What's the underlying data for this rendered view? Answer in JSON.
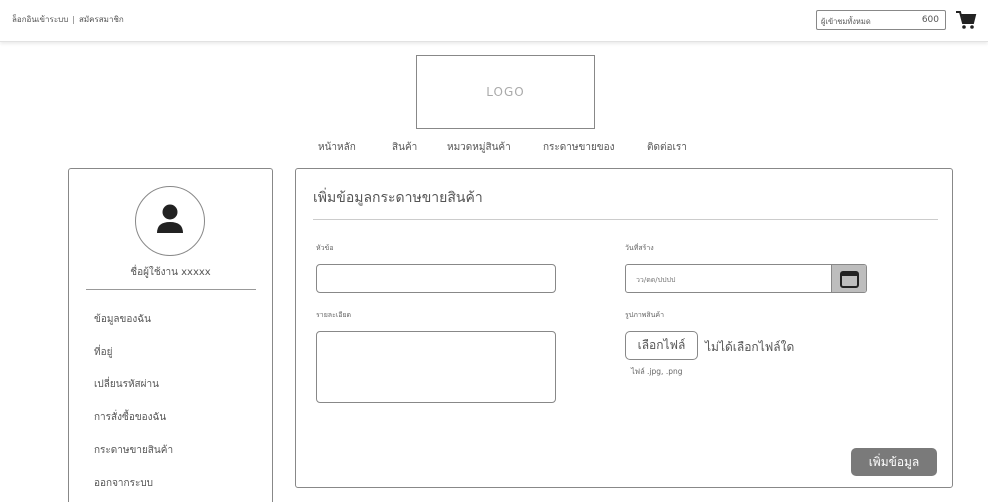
{
  "header": {
    "login_label": "ล็อกอินเข้าระบบ",
    "register_label": "สมัครสมาชิก",
    "separator": "|",
    "visitor_label": "ผู้เข้าชมทั้งหมด",
    "visitor_count": "600"
  },
  "logo": {
    "text": "LOGO"
  },
  "nav": {
    "items": [
      "หน้าหลัก",
      "สินค้า",
      "หมวดหมู่สินค้า",
      "กระดาษขายของ",
      "ติดต่อเรา"
    ]
  },
  "sidebar": {
    "username": "ชื่อผู้ใช้งาน xxxxx",
    "menu": [
      "ข้อมูลของฉัน",
      "ที่อยู่",
      "เปลี่ยนรหัสผ่าน",
      "การสั่งซื้อของฉัน",
      "กระดาษขายสินค้า",
      "ออกจากระบบ"
    ]
  },
  "form": {
    "title": "เพิ่มข้อมูลกระดาษขายสินค้า",
    "topic_label": "หัวข้อ",
    "topic_value": "",
    "date_label": "วันที่สร้าง",
    "date_placeholder": "วว/ดด/ปปปป",
    "detail_label": "รายละเอียด",
    "detail_value": "",
    "image_label": "รูปภาพสินค้า",
    "choose_file_label": "เลือกไฟล์",
    "no_file_label": "ไม่ได้เลือกไฟล์ใด",
    "file_hint": "ไฟล์ .jpg, .png",
    "submit_label": "เพิ่มข้อมูล"
  },
  "colors": {
    "border": "#888888",
    "submit_bg": "#7a7a7a",
    "calendar_button_bg": "#bdbdbd"
  },
  "icons": {
    "cart": "shopping-cart-icon",
    "user": "user-icon",
    "calendar": "calendar-icon"
  }
}
